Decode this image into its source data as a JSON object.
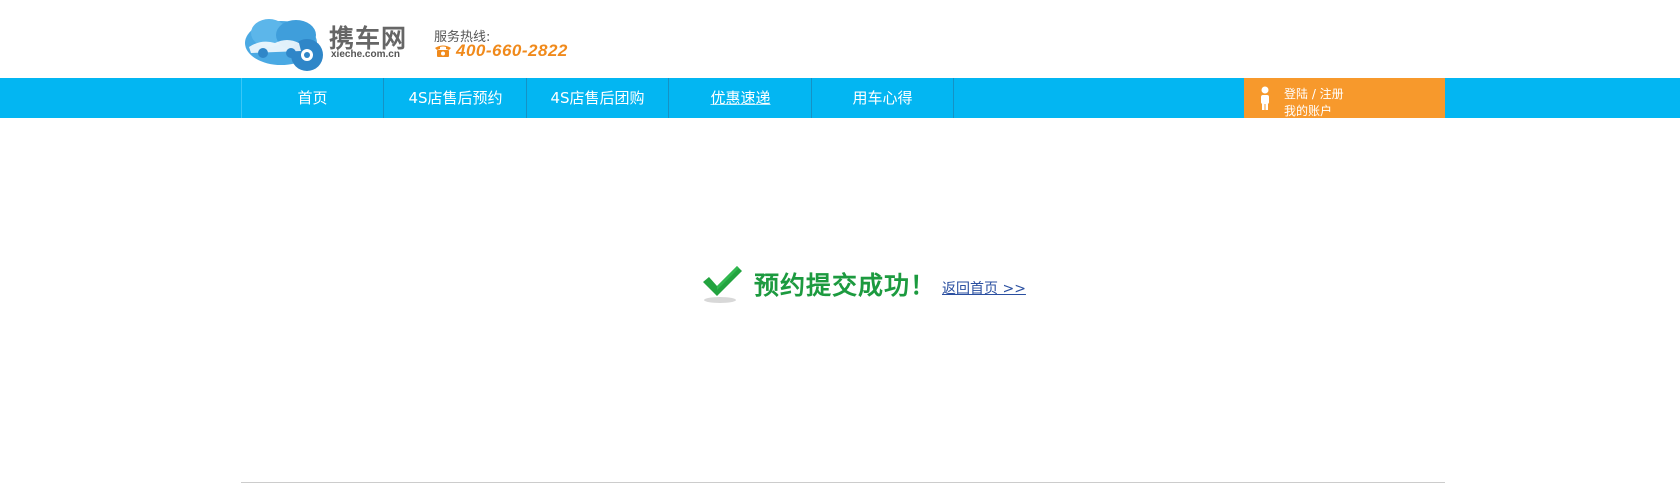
{
  "header": {
    "logo_cn": "携车网",
    "logo_en": "xieche.com.cn",
    "hotline_label": "服务热线:",
    "hotline_number": "400-660-2822"
  },
  "nav": {
    "items": [
      {
        "label": "首页"
      },
      {
        "label": "4S店售后预约"
      },
      {
        "label": "4S店售后团购"
      },
      {
        "label": "优惠速递"
      },
      {
        "label": "用车心得"
      }
    ],
    "login_label": "登陆 / 注册",
    "account_label": "我的账户"
  },
  "main": {
    "success_message": "预约提交成功！",
    "back_link": "返回首页 >>"
  },
  "colors": {
    "nav_bg": "#03b6f2",
    "account_bg": "#f7992c",
    "success_green": "#1c9a3f",
    "hotline_orange": "#f08a1c",
    "link_blue": "#2a4fa0"
  }
}
